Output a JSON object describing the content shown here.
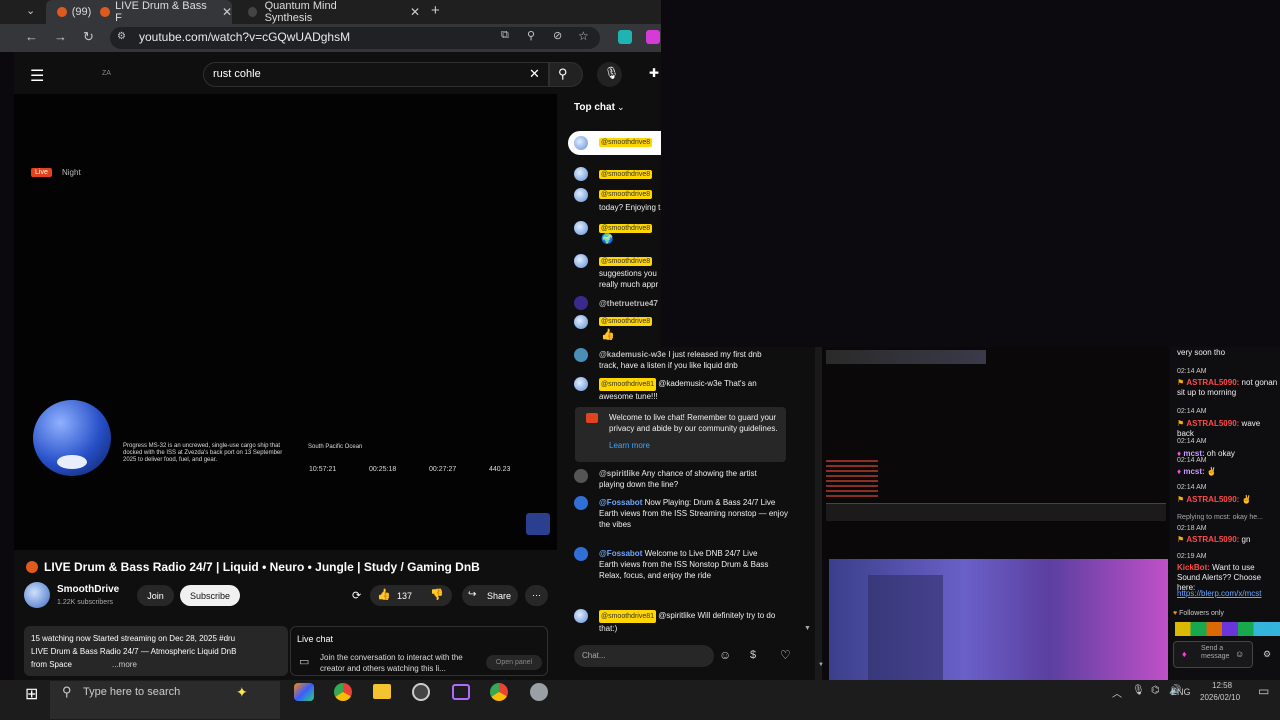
{
  "browser": {
    "tabs": [
      {
        "count": "(99)",
        "title": "LIVE Drum & Bass F",
        "active": true
      },
      {
        "title": "Quantum Mind Synthesis",
        "active": false
      }
    ],
    "new_tab": "+",
    "url": "youtube.com/watch?v=cGQwUADghsM"
  },
  "youtube": {
    "logo_text": "ZA",
    "search_value": "rust cohle",
    "video_overlay": {
      "live_badge": "Live",
      "night_label": "Night",
      "iss_description": "Progress MS-32 is an uncrewed, single-use cargo ship that docked with the ISS at Zvezda's back port on 13 September 2025 to deliver food, fuel, and gear.",
      "location": "South Pacific Ocean",
      "stats": [
        "10:57:21",
        "00:25:18",
        "00:27:27",
        "440.23"
      ]
    },
    "title": "LIVE Drum & Bass Radio 24/7 | Liquid • Neuro • Jungle | Study / Gaming DnB",
    "channel": {
      "name": "SmoothDrive",
      "subscribers": "1.22K subscribers"
    },
    "join_label": "Join",
    "subscribe_label": "Subscribe",
    "like_count": "137",
    "share_label": "Share",
    "description": {
      "line1": "15 watching now  Started streaming on Dec 28, 2025  #dru",
      "line2": "LIVE Drum & Bass Radio 24/7 — Atmospheric Liquid DnB",
      "line3": "from Space",
      "more": "...more"
    },
    "live_chat_panel": {
      "title": "Live chat",
      "text": "Join the conversation to interact with the creator and others watching this li...",
      "open_panel": "Open panel"
    }
  },
  "chat": {
    "header": "Top chat",
    "narrow_messages": [
      {
        "author": "@smoothdrive8",
        "text": ""
      },
      {
        "author": "@smoothdrive8",
        "text": ""
      },
      {
        "author": "@smoothdrive8",
        "text": "today? Enjoying t"
      },
      {
        "author": "@smoothdrive8",
        "text": ""
      },
      {
        "author": "@smoothdrive8",
        "text": "suggestions you really much appr"
      },
      {
        "author": "@thetruetrue47",
        "text": ""
      },
      {
        "author": "@smoothdrive8",
        "text": ""
      }
    ],
    "wide_messages": [
      {
        "author": "@kademusic-w3e",
        "text": "I just released my first dnb track, have a listen if you like liquid dnb"
      },
      {
        "author": "@smoothdrive81",
        "text": "@kademusic-w3e That's an awesome tune!!!"
      },
      {
        "author": "@spiritlike",
        "text": "Any chance of showing the artist playing down the line?"
      },
      {
        "author": "@Fossabot",
        "text": "Now Playing: Drum & Bass 24/7 Live Earth views from the ISS Streaming nonstop — enjoy the vibes"
      },
      {
        "author": "@Fossabot",
        "text": "Welcome to Live DNB 24/7 Live Earth views from the ISS Nonstop Drum & Bass Relax, focus, and enjoy the ride"
      },
      {
        "author": "@smoothdrive81",
        "text": "@spiritlike Will definitely try to do that:)"
      }
    ],
    "welcome": "Welcome to live chat! Remember to guard your privacy and abide by our community guidelines.",
    "learn_more": "Learn more",
    "placeholder": "Chat..."
  },
  "twitch_chat": {
    "lines": [
      {
        "time": "",
        "name": "",
        "text": "very soon tho"
      },
      {
        "time": "02:14 AM",
        "name": "ASTRAL5090:",
        "text": "not gonan sit up to morning"
      },
      {
        "time": "02:14 AM",
        "name": "ASTRAL5090:",
        "text": "wave back"
      },
      {
        "time": "02:14 AM",
        "name": "mcst:",
        "text": "oh okay"
      },
      {
        "time": "02:14 AM",
        "name": "mcst:",
        "text": ""
      },
      {
        "time": "02:14 AM",
        "name": "ASTRAL5090:",
        "text": ""
      },
      {
        "time": "",
        "name": "",
        "text": "Replying to mcst: okay he..."
      },
      {
        "time": "02:18 AM",
        "name": "ASTRAL5090:",
        "text": "gn"
      },
      {
        "time": "02:19 AM",
        "name": "KickBot:",
        "text": "Want to use Sound Alerts?? Choose here:"
      },
      {
        "time": "",
        "name": "",
        "text": "https://blerp.com/x/mcst"
      }
    ],
    "followers_only": "Followers only",
    "send_placeholder": "Send a message"
  },
  "taskbar": {
    "search_placeholder": "Type here to search",
    "lang": "ENG",
    "time": "12:58",
    "date": "2026/02/10"
  },
  "colors": {
    "youtube_bg": "#0f0f0f",
    "accent_yellow": "#ffd600",
    "live_red": "#e0431e",
    "subscribe_bg": "#f1f1f1"
  }
}
